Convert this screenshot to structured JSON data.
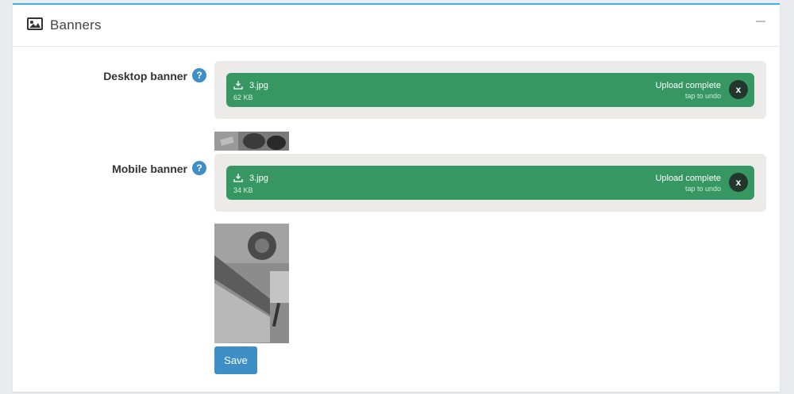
{
  "panel": {
    "title": "Banners",
    "header_icon": "image-icon",
    "collapse_icon": "minus-icon"
  },
  "fields": [
    {
      "label": "Desktop banner",
      "help_icon": "question-circle-icon",
      "help_glyph": "?",
      "file": {
        "name": "3.jpg",
        "size": "62 KB",
        "status": "Upload complete",
        "status_sub": "tap to undo",
        "remove_glyph": "x"
      }
    },
    {
      "label": "Mobile banner",
      "help_icon": "question-circle-icon",
      "help_glyph": "?",
      "file": {
        "name": "3.jpg",
        "size": "34 KB",
        "status": "Upload complete",
        "status_sub": "tap to undo",
        "remove_glyph": "x"
      }
    }
  ],
  "actions": {
    "save_label": "Save"
  },
  "colors": {
    "accent_top": "#3bb4e5",
    "upload_success": "#369763",
    "button_primary": "#3d8fc6"
  }
}
